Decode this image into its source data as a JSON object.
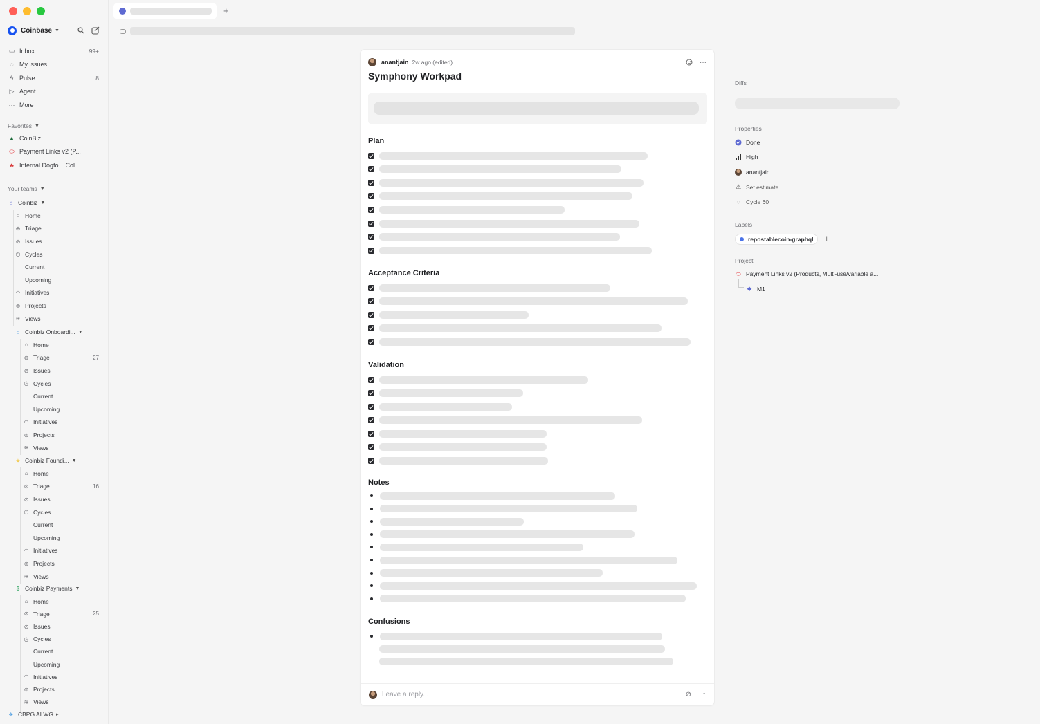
{
  "workspace": {
    "name": "Coinbase"
  },
  "colors": {
    "accent": "#5e6ad2",
    "done": "#5e6ad2",
    "project": "#e5484d",
    "label_dot": "#4b73e8"
  },
  "nav": [
    {
      "label": "Inbox",
      "count": "99+",
      "icon": "inbox-icon"
    },
    {
      "label": "My issues",
      "count": "",
      "icon": "my-issues-icon"
    },
    {
      "label": "Pulse",
      "count": "8",
      "icon": "pulse-icon"
    },
    {
      "label": "Agent",
      "count": "",
      "icon": "agent-icon"
    },
    {
      "label": "More",
      "count": "",
      "icon": "more-icon"
    }
  ],
  "favorites": {
    "header": "Favorites",
    "items": [
      {
        "label": "CoinBiz"
      },
      {
        "label": "Payment Links v2 (P..."
      },
      {
        "label": "Internal Dogfo... Col..."
      }
    ]
  },
  "teams_header": "Your teams",
  "teams": [
    {
      "name": "Coinbiz",
      "items": [
        {
          "label": "Home",
          "count": ""
        },
        {
          "label": "Triage",
          "count": ""
        },
        {
          "label": "Issues",
          "count": ""
        },
        {
          "label": "Cycles",
          "count": ""
        },
        {
          "label": "Current",
          "count": ""
        },
        {
          "label": "Upcoming",
          "count": ""
        },
        {
          "label": "Initiatives",
          "count": ""
        },
        {
          "label": "Projects",
          "count": ""
        },
        {
          "label": "Views",
          "count": ""
        }
      ]
    },
    {
      "name": "Coinbiz Onboardi...",
      "items": [
        {
          "label": "Home",
          "count": ""
        },
        {
          "label": "Triage",
          "count": "27"
        },
        {
          "label": "Issues",
          "count": ""
        },
        {
          "label": "Cycles",
          "count": ""
        },
        {
          "label": "Current",
          "count": ""
        },
        {
          "label": "Upcoming",
          "count": ""
        },
        {
          "label": "Initiatives",
          "count": ""
        },
        {
          "label": "Projects",
          "count": ""
        },
        {
          "label": "Views",
          "count": ""
        }
      ]
    },
    {
      "name": "Coinbiz Foundi...",
      "items": [
        {
          "label": "Home",
          "count": ""
        },
        {
          "label": "Triage",
          "count": "16"
        },
        {
          "label": "Issues",
          "count": ""
        },
        {
          "label": "Cycles",
          "count": ""
        },
        {
          "label": "Current",
          "count": ""
        },
        {
          "label": "Upcoming",
          "count": ""
        },
        {
          "label": "Initiatives",
          "count": ""
        },
        {
          "label": "Projects",
          "count": ""
        },
        {
          "label": "Views",
          "count": ""
        }
      ]
    },
    {
      "name": "Coinbiz Payments",
      "items": [
        {
          "label": "Home",
          "count": ""
        },
        {
          "label": "Triage",
          "count": "25"
        },
        {
          "label": "Issues",
          "count": ""
        },
        {
          "label": "Cycles",
          "count": ""
        },
        {
          "label": "Current",
          "count": ""
        },
        {
          "label": "Upcoming",
          "count": ""
        },
        {
          "label": "Initiatives",
          "count": ""
        },
        {
          "label": "Projects",
          "count": ""
        },
        {
          "label": "Views",
          "count": ""
        }
      ]
    },
    {
      "name": "CBPG AI WG",
      "items": []
    }
  ],
  "comment": {
    "author": "anantjain",
    "meta": "2w ago (edited)",
    "title": "Symphony Workpad",
    "sections": [
      {
        "heading": "Plan",
        "kind": "checkbox",
        "count": 8
      },
      {
        "heading": "Acceptance Criteria",
        "kind": "checkbox",
        "count": 5
      },
      {
        "heading": "Validation",
        "kind": "checkbox",
        "count": 7
      },
      {
        "heading": "Notes",
        "kind": "bullet",
        "count": 9
      },
      {
        "heading": "Confusions",
        "kind": "bullet",
        "count": 1
      }
    ],
    "reply_placeholder": "Leave a reply..."
  },
  "props": {
    "diffs_header": "Diffs",
    "properties_header": "Properties",
    "status": "Done",
    "priority": "High",
    "assignee": "anantjain",
    "estimate": "Set estimate",
    "cycle": "Cycle 60",
    "labels_header": "Labels",
    "label": "repostablecoin-graphql",
    "project_header": "Project",
    "project": "Payment Links v2 (Products, Multi-use/variable a...",
    "milestone": "M1"
  }
}
